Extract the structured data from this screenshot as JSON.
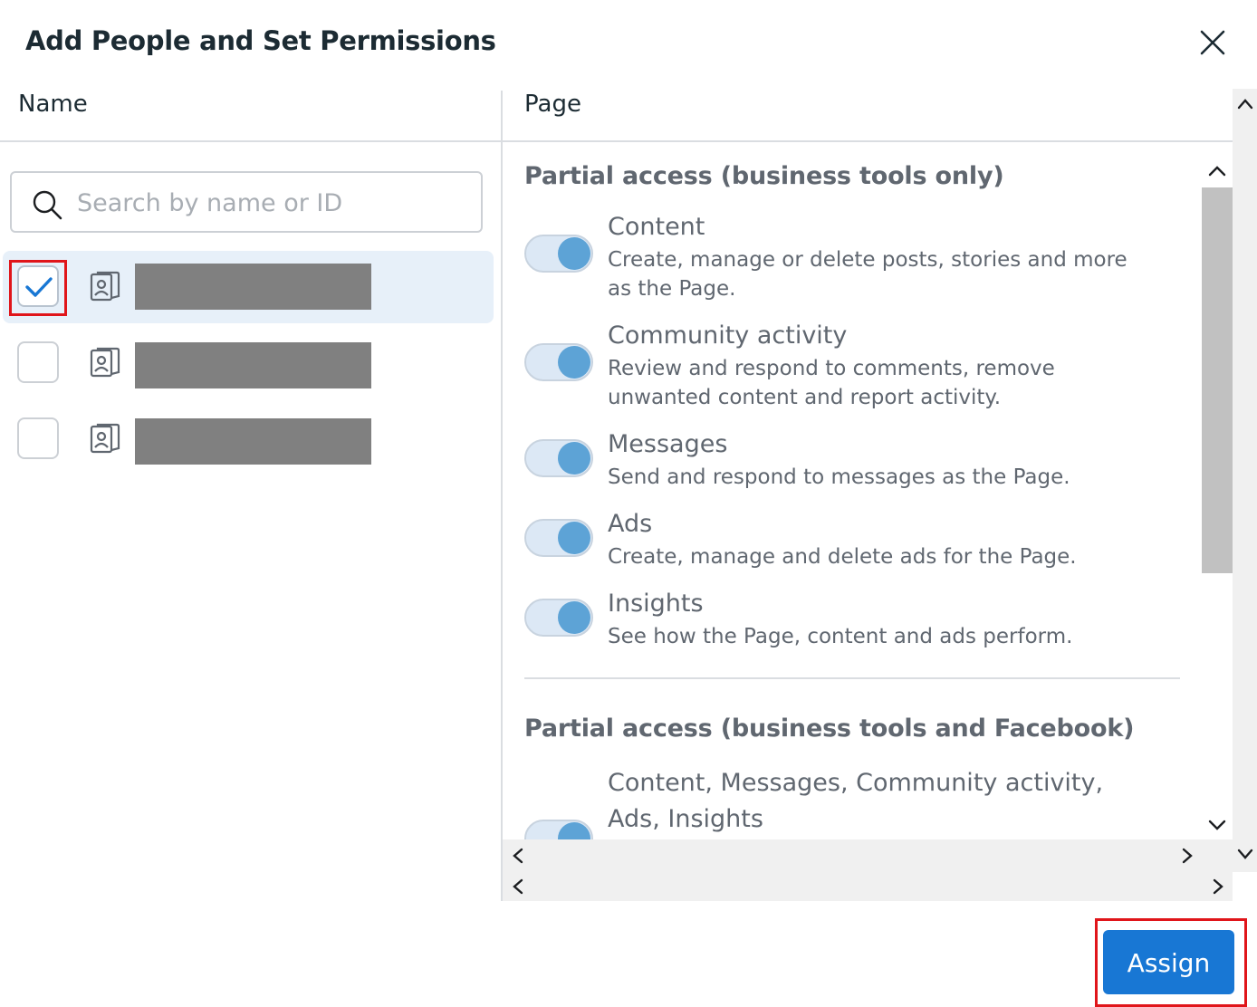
{
  "dialog": {
    "title": "Add People and Set Permissions"
  },
  "columns": {
    "name_header": "Name",
    "page_header": "Page"
  },
  "search": {
    "placeholder": "Search by name or ID",
    "value": ""
  },
  "people": [
    {
      "checked": true,
      "name_redacted": true
    },
    {
      "checked": false,
      "name_redacted": true
    },
    {
      "checked": false,
      "name_redacted": true
    }
  ],
  "sections": [
    {
      "title": "Partial access (business tools only)",
      "permissions": [
        {
          "name": "Content",
          "description": "Create, manage or delete posts, stories and more as the Page.",
          "enabled": true
        },
        {
          "name": "Community activity",
          "description": "Review and respond to comments, remove unwanted content and report activity.",
          "enabled": true
        },
        {
          "name": "Messages",
          "description": "Send and respond to messages as the Page.",
          "enabled": true
        },
        {
          "name": "Ads",
          "description": "Create, manage and delete ads for the Page.",
          "enabled": true
        },
        {
          "name": "Insights",
          "description": "See how the Page, content and ads perform.",
          "enabled": true
        }
      ]
    },
    {
      "title": "Partial access (business tools and Facebook)",
      "permissions": [
        {
          "name": "Content, Messages, Community activity, Ads, Insights",
          "enabled": true
        }
      ]
    }
  ],
  "footer": {
    "assign_label": "Assign"
  },
  "colors": {
    "primary": "#1877d4",
    "toggle_knob": "#5da3d6",
    "selected_row": "#e7f0f9",
    "highlight_box": "#e0151a"
  }
}
